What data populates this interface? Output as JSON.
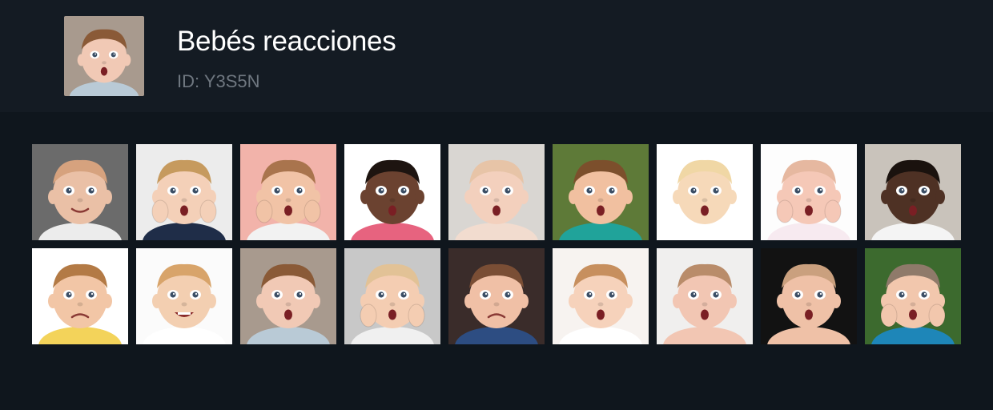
{
  "pack": {
    "title": "Bebés reacciones",
    "id_label": "ID: Y3S5N"
  },
  "header_thumb": {
    "bg": "#a89a8e",
    "skin": "#f1c9b5",
    "hair": "#8a5a37",
    "shirt": "#b9cad6",
    "mouth": "o",
    "hand": false,
    "name": "baby-sticker-thumbnail"
  },
  "stickers": [
    {
      "bg": "#6b6b6b",
      "skin": "#eac0a6",
      "hair": "#d6a27e",
      "shirt": "#ececec",
      "mouth": "smile",
      "hand": false,
      "name": "sticker-01"
    },
    {
      "bg": "#ececec",
      "skin": "#f4d0b8",
      "hair": "#c69a5e",
      "shirt": "#1f2d48",
      "mouth": "o",
      "hand": true,
      "name": "sticker-02"
    },
    {
      "bg": "#f2b3aa",
      "skin": "#f1c3a6",
      "hair": "#a9744d",
      "shirt": "#f2f2f2",
      "mouth": "o",
      "hand": true,
      "name": "sticker-03"
    },
    {
      "bg": "#ffffff",
      "skin": "#6b4230",
      "hair": "#1d1410",
      "shirt": "#e7637f",
      "mouth": "o",
      "hand": false,
      "name": "sticker-04"
    },
    {
      "bg": "#d9d6d2",
      "skin": "#f3d0bd",
      "hair": "#e7c4a7",
      "shirt": "#f2dccf",
      "mouth": "o",
      "hand": false,
      "name": "sticker-05"
    },
    {
      "bg": "#5e7a38",
      "skin": "#f1c0a0",
      "hair": "#7c4f2c",
      "shirt": "#20a39a",
      "mouth": "o",
      "hand": false,
      "name": "sticker-06"
    },
    {
      "bg": "#ffffff",
      "skin": "#f6d9b9",
      "hair": "#f0d7a5",
      "shirt": "#ffffff",
      "mouth": "o",
      "hand": false,
      "name": "sticker-07"
    },
    {
      "bg": "#fdfdfd",
      "skin": "#f5c8b7",
      "hair": "#e6b8a0",
      "shirt": "#f7eaf0",
      "mouth": "o",
      "hand": true,
      "name": "sticker-08"
    },
    {
      "bg": "#c9c3bb",
      "skin": "#4e3124",
      "hair": "#1a120e",
      "shirt": "#f4f4f4",
      "mouth": "o",
      "hand": false,
      "name": "sticker-09"
    },
    {
      "bg": "#ffffff",
      "skin": "#f2c6a6",
      "hair": "#b37a45",
      "shirt": "#f3d35a",
      "mouth": "frown",
      "hand": false,
      "name": "sticker-10"
    },
    {
      "bg": "#fbfbfb",
      "skin": "#f3cfb1",
      "hair": "#d8a46a",
      "shirt": "#ffffff",
      "mouth": "grin",
      "hand": false,
      "name": "sticker-11"
    },
    {
      "bg": "#a89a8e",
      "skin": "#f1c9b5",
      "hair": "#8a5a37",
      "shirt": "#b9cad6",
      "mouth": "o",
      "hand": false,
      "name": "sticker-12"
    },
    {
      "bg": "#c8c8c8",
      "skin": "#f4cdb2",
      "hair": "#e2c296",
      "shirt": "#f0f0f0",
      "mouth": "o",
      "hand": true,
      "name": "sticker-13"
    },
    {
      "bg": "#3a2c2a",
      "skin": "#f0c0a6",
      "hair": "#7a4e35",
      "shirt": "#2d4d82",
      "mouth": "frown",
      "hand": false,
      "name": "sticker-14"
    },
    {
      "bg": "#f7f3f0",
      "skin": "#f6d2bb",
      "hair": "#c78f5e",
      "shirt": "#ffffff",
      "mouth": "o",
      "hand": false,
      "name": "sticker-15"
    },
    {
      "bg": "#f0efee",
      "skin": "#f2c6b3",
      "hair": "#b98c6a",
      "shirt": "#f2c6b3",
      "mouth": "o",
      "hand": false,
      "name": "sticker-16"
    },
    {
      "bg": "#121212",
      "skin": "#efc1a7",
      "hair": "#caa07e",
      "shirt": "#efc1a7",
      "mouth": "o",
      "hand": false,
      "name": "sticker-17"
    },
    {
      "bg": "#3c6a2e",
      "skin": "#f2c7ad",
      "hair": "#8f7a6a",
      "shirt": "#1e86b8",
      "mouth": "o",
      "hand": true,
      "name": "sticker-18"
    }
  ]
}
